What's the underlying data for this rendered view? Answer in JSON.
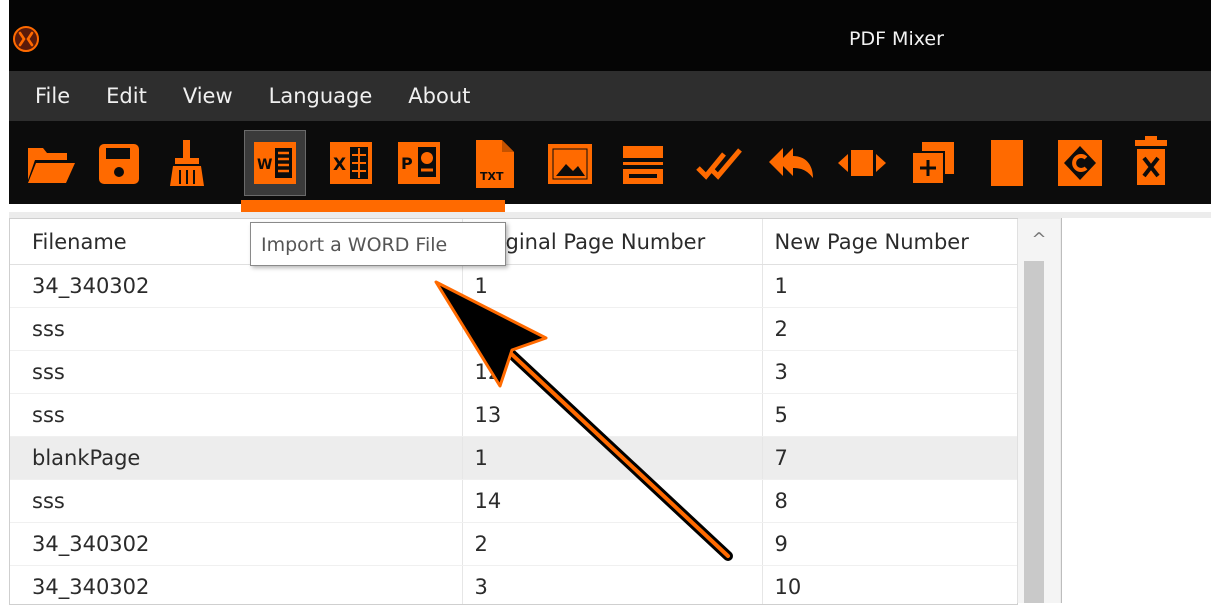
{
  "window": {
    "title": "PDF Mixer",
    "accent_color": "#ff6a00"
  },
  "menu": {
    "items": [
      {
        "label": "File"
      },
      {
        "label": "Edit"
      },
      {
        "label": "View"
      },
      {
        "label": "Language"
      },
      {
        "label": "About"
      }
    ]
  },
  "toolbar": {
    "buttons": [
      {
        "icon": "open-folder-icon"
      },
      {
        "icon": "save-icon"
      },
      {
        "icon": "broom-clear-icon"
      },
      {
        "icon": "word-import-icon",
        "state": "hovered"
      },
      {
        "icon": "excel-import-icon"
      },
      {
        "icon": "powerpoint-import-icon"
      },
      {
        "icon": "txt-import-icon"
      },
      {
        "icon": "image-import-icon"
      },
      {
        "icon": "scanner-icon"
      },
      {
        "icon": "check-all-icon"
      },
      {
        "icon": "reply-all-icon"
      },
      {
        "icon": "resize-horizontal-icon"
      },
      {
        "icon": "add-page-icon"
      },
      {
        "icon": "blank-page-icon"
      },
      {
        "icon": "rotate-icon"
      },
      {
        "icon": "delete-icon"
      }
    ]
  },
  "tooltip": {
    "text": "Import a WORD File"
  },
  "table": {
    "headers": {
      "filename": "Filename",
      "original": "Original Page Number",
      "new": "New Page Number"
    },
    "rows": [
      {
        "filename": "34_340302",
        "original": "1",
        "new": "1"
      },
      {
        "filename": "sss",
        "original": "",
        "new": "2"
      },
      {
        "filename": "sss",
        "original": "12",
        "new": "3"
      },
      {
        "filename": "sss",
        "original": "13",
        "new": "5"
      },
      {
        "filename": "blankPage",
        "original": "1",
        "new": "7",
        "selected": true
      },
      {
        "filename": "sss",
        "original": "14",
        "new": "8"
      },
      {
        "filename": "34_340302",
        "original": "2",
        "new": "9"
      },
      {
        "filename": "34_340302",
        "original": "3",
        "new": "10"
      }
    ]
  }
}
